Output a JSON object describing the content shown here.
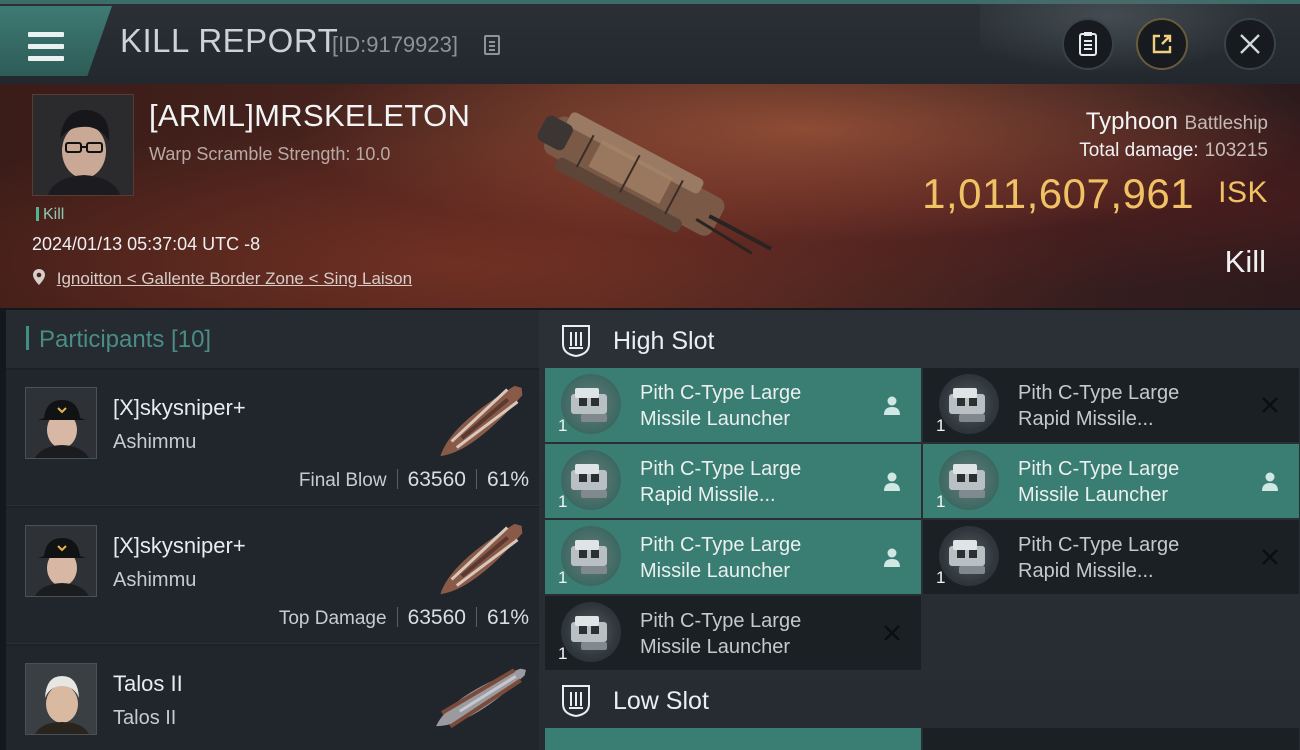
{
  "header": {
    "title": "KILL REPORT",
    "report_id": "[ID:9179923]",
    "icons": [
      "menu-icon",
      "copy-icon",
      "clipboard-icon",
      "share-icon",
      "close-icon"
    ]
  },
  "victim": {
    "name": "[ARML]MRSKELETON",
    "subtitle": "Warp Scramble Strength: 10.0",
    "tag": "Kill",
    "datetime": "2024/01/13 05:37:04 UTC -8",
    "location": "Ignoitton < Gallente Border Zone < Sing Laison",
    "ship_name": "Typhoon",
    "ship_class": "Battleship",
    "damage_label": "Total damage:",
    "damage_value": "103215",
    "isk_value": "1,011,607,961",
    "isk_unit": "ISK",
    "result": "Kill"
  },
  "participants": {
    "title": "Participants [10]",
    "rows": [
      {
        "name": "[X]skysniper+",
        "ship": "Ashimmu",
        "role": "Final Blow",
        "damage": "63560",
        "percent": "61%"
      },
      {
        "name": "[X]skysniper+",
        "ship": "Ashimmu",
        "role": "Top Damage",
        "damage": "63560",
        "percent": "61%"
      },
      {
        "name": "Talos II",
        "ship": "Talos II",
        "role": "",
        "damage": "",
        "percent": ""
      }
    ]
  },
  "slots": {
    "high_title": "High Slot",
    "low_title": "Low Slot",
    "high_modules": [
      {
        "line1": "Pith C-Type Large",
        "line2": "Missile Launcher",
        "qty": "1",
        "state": "active",
        "status_icon": "person-icon"
      },
      {
        "line1": "Pith C-Type Large",
        "line2": "Rapid Missile...",
        "qty": "1",
        "state": "inactive",
        "status_icon": "close-icon"
      },
      {
        "line1": "Pith C-Type Large",
        "line2": "Rapid Missile...",
        "qty": "1",
        "state": "active",
        "status_icon": "person-icon"
      },
      {
        "line1": "Pith C-Type Large",
        "line2": "Missile Launcher",
        "qty": "1",
        "state": "active",
        "status_icon": "person-icon"
      },
      {
        "line1": "Pith C-Type Large",
        "line2": "Missile Launcher",
        "qty": "1",
        "state": "active",
        "status_icon": "person-icon"
      },
      {
        "line1": "Pith C-Type Large",
        "line2": "Rapid Missile...",
        "qty": "1",
        "state": "inactive",
        "status_icon": "close-icon"
      },
      {
        "line1": "Pith C-Type Large",
        "line2": "Missile Launcher",
        "qty": "1",
        "state": "inactive",
        "status_icon": "close-icon"
      }
    ]
  },
  "colors": {
    "accent": "#3f8f87",
    "active_slot": "#3a7d72",
    "isk_gold": "#f0c263",
    "kill_green": "#4fb892"
  }
}
